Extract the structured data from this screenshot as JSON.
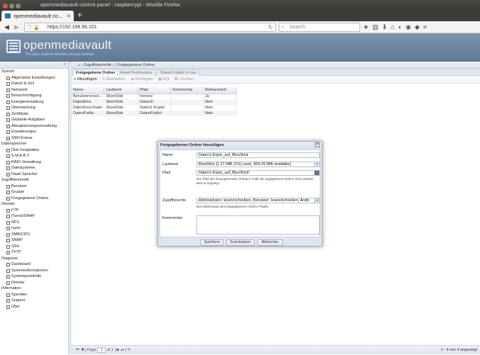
{
  "window": {
    "title": "openmediavault control panel - raspberrypi - Mozilla Firefox"
  },
  "browser": {
    "tab_title": "openmediavault co...",
    "url": "https://192.168.56.101",
    "search_placeholder": "Search"
  },
  "app": {
    "logo": "openmediavault",
    "tagline": "The open network attached storage solution"
  },
  "sidebar": {
    "groups": [
      {
        "label": "System",
        "items": [
          "Allgemeine Einstellungen",
          "Datum & Zeit",
          "Netzwerk",
          "Benachrichtigung",
          "Energieverwaltung",
          "Überwachung",
          "Zertifikate",
          "Geplante Aufgaben",
          "Aktualisierungsverwaltung",
          "Erweiterungen",
          "OMV-Extras"
        ]
      },
      {
        "label": "Datenspeicher",
        "items": [
          "Disk Festplatten",
          "S.M.A.R.T.",
          "RAID Verwaltung",
          "Dateisysteme",
          "Flash Speicher"
        ]
      },
      {
        "label": "Zugriffskontrolle",
        "items": [
          "Benutzer",
          "Gruppe",
          "Freigegebene Ordner"
        ]
      },
      {
        "label": "Dienste",
        "items": [
          "FTP",
          "iTunes/DAAP",
          "NFS",
          "rsync",
          "SMB/CIFS",
          "SNMP",
          "SSH",
          "TFTP"
        ]
      },
      {
        "label": "Diagnose",
        "items": [
          "Dashboard",
          "Systeminformationen",
          "Systemprotokolle",
          "Dienste"
        ]
      },
      {
        "label": "Information",
        "items": [
          "Spenden",
          "Support",
          "Über"
        ]
      }
    ]
  },
  "breadcrumb": {
    "first": "Zugriffskontrolle",
    "second": "Freigegebene Ordner"
  },
  "tabs": [
    "Freigegebene Ordner",
    "Reset Permissions",
    "Shared Folder in Use"
  ],
  "toolbar": {
    "add": "Hinzufügen",
    "edit": "Bearbeiten",
    "privileges": "Privilegien",
    "acl": "ACL",
    "delete": "Löschen"
  },
  "table": {
    "columns": [
      "Name",
      "Laufwerk",
      "Pfad",
      "Kommentar",
      "Referenziert"
    ],
    "rows": [
      [
        "Benutzerverzei...",
        "SilverDisk",
        "homes/",
        "",
        "Ja"
      ],
      [
        "DatenEins",
        "SilverDisk",
        "Daten1/",
        "",
        "Nein"
      ],
      [
        "DatenEins-Kopie",
        "SilverDisk",
        "Daten1-Kopie/",
        "",
        "Nein"
      ],
      [
        "DatenPublic",
        "SilverDisk",
        "DatenPublic/",
        "",
        "Nein"
      ]
    ]
  },
  "footer": {
    "page_label": "Page",
    "page_value": "1",
    "of_label": "of 1",
    "count": "1 - 4 von 4 angezeigt"
  },
  "dialog": {
    "title": "Freigegebenen Ordner hinzufügen",
    "name_label": "Name",
    "name_value": "Daten1-Kopie_auf_BlueStick",
    "drive_label": "Laufwerk",
    "drive_value": "BlueStick [1.17 MiB (1%) used, 904.29 MiB available]",
    "path_label": "Pfad",
    "path_value": "Daten1-Kopie_auf_BlueStick/",
    "path_hint": "Der Pfad des freizugebenden Ordners. Falls der angegebene Ordner nicht existiert wird er angelegt.",
    "perm_label": "Zugriffsrechte",
    "perm_value": "Administrator: lesen/schreiben, Benutzer: lesen/schreiben, Ande",
    "perm_hint": "Der Dateimodus des freigegebenen Ordner Pfades.",
    "comment_label": "Kommentar",
    "save": "Speichern",
    "reset": "Zurücksetzen",
    "cancel": "Abbrechen"
  },
  "colors": {
    "header": "#6d86a3",
    "accent": "#2b6fa8"
  }
}
